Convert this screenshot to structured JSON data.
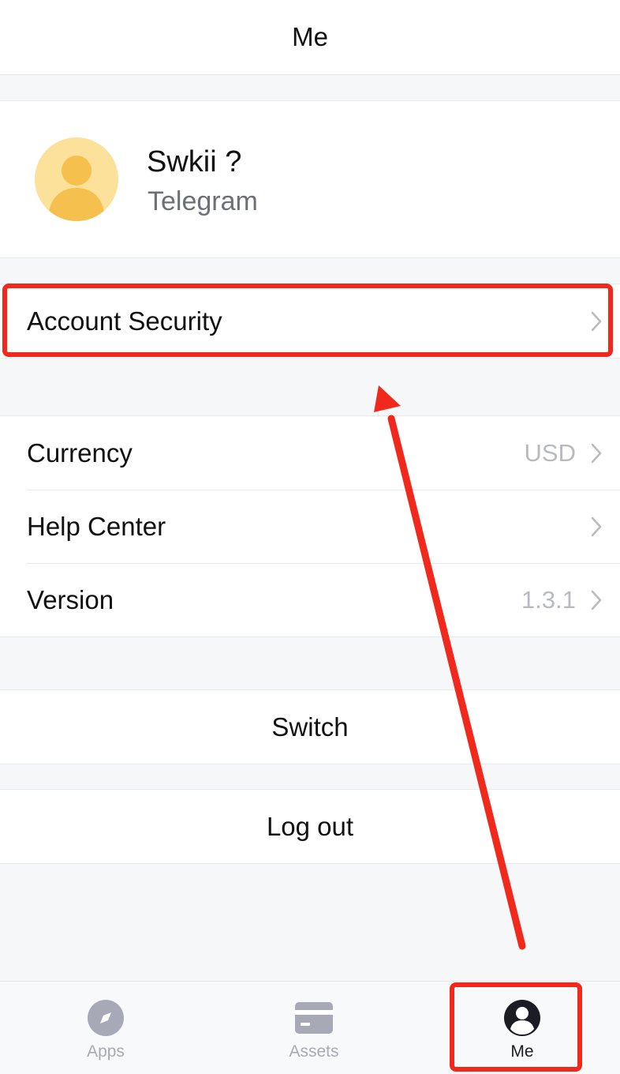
{
  "header": {
    "title": "Me"
  },
  "profile": {
    "name": "Swkii ?",
    "platform": "Telegram",
    "avatar_icon": "user-avatar-icon"
  },
  "settings": {
    "account_security": {
      "label": "Account Security"
    },
    "currency": {
      "label": "Currency",
      "value": "USD"
    },
    "help_center": {
      "label": "Help Center"
    },
    "version": {
      "label": "Version",
      "value": "1.3.1"
    }
  },
  "actions": {
    "switch_label": "Switch",
    "logout_label": "Log out"
  },
  "tabbar": {
    "items": [
      {
        "label": "Apps",
        "icon": "compass-icon",
        "active": false
      },
      {
        "label": "Assets",
        "icon": "card-icon",
        "active": false
      },
      {
        "label": "Me",
        "icon": "user-circle-icon",
        "active": true
      }
    ]
  },
  "colors": {
    "highlight": "#f0291c",
    "avatar_bg": "#fce19a",
    "avatar_fg": "#f5c04e",
    "inactive_tab": "#a7a9b7",
    "active_tab": "#1c1c24"
  }
}
